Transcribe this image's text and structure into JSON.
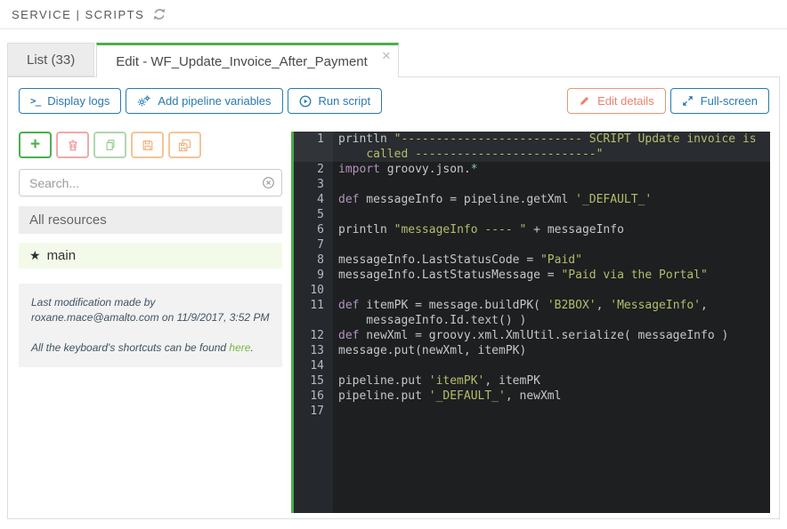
{
  "breadcrumb": {
    "text": "SERVICE | SCRIPTS"
  },
  "tabs": {
    "list": {
      "label": "List (33)"
    },
    "edit": {
      "label": "Edit - WF_Update_Invoice_After_Payment",
      "close_label": "×"
    }
  },
  "toolbar": {
    "display_logs": "Display logs",
    "terminal_glyph": ">_",
    "add_pipeline_variables": "Add pipeline variables",
    "run_script": "Run script",
    "edit_details": "Edit details",
    "full_screen": "Full-screen"
  },
  "sidebar": {
    "icon_buttons": [
      "add",
      "delete",
      "duplicate",
      "save",
      "save-all"
    ],
    "search_placeholder": "Search...",
    "all_resources_label": "All resources",
    "main_item_label": "main",
    "star_glyph": "★",
    "plus_glyph": "+",
    "info_line1": "Last modification made by roxane.mace@amalto.com on 11/9/2017, 3:52 PM",
    "shortcuts_prefix": "All the keyboard's shortcuts can be found ",
    "shortcuts_link": "here",
    "shortcuts_suffix": "."
  },
  "colors": {
    "accent_green": "#4cae4c",
    "accent_blue": "#2779af",
    "accent_orange": "#e8836f",
    "editor_bg": "#1d1f21",
    "editor_gutter_bg": "#25282c",
    "code_string": "#b5bd68",
    "code_keyword": "#b294bb",
    "code_plain": "#c5c8c6",
    "info_link_green": "#7ab648"
  },
  "editor": {
    "lines": [
      {
        "n": 1,
        "active": true,
        "rows": [
          [
            [
              "println ",
              "p"
            ],
            [
              "\"-------------------------- SCRIPT Update invoice is",
              "s"
            ]
          ],
          [
            [
              "    ",
              "p"
            ],
            [
              "called --------------------------\"",
              "s"
            ]
          ]
        ]
      },
      {
        "n": 2,
        "rows": [
          [
            [
              "import",
              "k"
            ],
            [
              " groovy.json.",
              "p"
            ],
            [
              "*",
              "c"
            ]
          ]
        ]
      },
      {
        "n": 3,
        "rows": [
          []
        ]
      },
      {
        "n": 4,
        "rows": [
          [
            [
              "def",
              "k"
            ],
            [
              " messageInfo = pipeline.getXml ",
              "p"
            ],
            [
              "'_DEFAULT_'",
              "s"
            ]
          ]
        ]
      },
      {
        "n": 5,
        "rows": [
          []
        ]
      },
      {
        "n": 6,
        "rows": [
          [
            [
              "println ",
              "p"
            ],
            [
              "\"messageInfo ---- \"",
              "s"
            ],
            [
              " + messageInfo",
              "p"
            ]
          ]
        ]
      },
      {
        "n": 7,
        "rows": [
          []
        ]
      },
      {
        "n": 8,
        "rows": [
          [
            [
              "messageInfo.LastStatusCode = ",
              "p"
            ],
            [
              "\"Paid\"",
              "s"
            ]
          ]
        ]
      },
      {
        "n": 9,
        "rows": [
          [
            [
              "messageInfo.LastStatusMessage = ",
              "p"
            ],
            [
              "\"Paid via the Portal\"",
              "s"
            ]
          ]
        ]
      },
      {
        "n": 10,
        "rows": [
          []
        ]
      },
      {
        "n": 11,
        "rows": [
          [
            [
              "def",
              "k"
            ],
            [
              " itemPK = message.buildPK( ",
              "p"
            ],
            [
              "'B2BOX'",
              "s"
            ],
            [
              ", ",
              "p"
            ],
            [
              "'MessageInfo'",
              "s"
            ],
            [
              ",",
              "p"
            ]
          ],
          [
            [
              "    messageInfo.Id.text() )",
              "p"
            ]
          ]
        ]
      },
      {
        "n": 12,
        "rows": [
          [
            [
              "def",
              "k"
            ],
            [
              " newXml = groovy.xml.XmlUtil.serialize( messageInfo )",
              "p"
            ]
          ]
        ]
      },
      {
        "n": 13,
        "rows": [
          [
            [
              "message.put(newXml, itemPK)",
              "p"
            ]
          ]
        ]
      },
      {
        "n": 14,
        "rows": [
          []
        ]
      },
      {
        "n": 15,
        "rows": [
          [
            [
              "pipeline.put ",
              "p"
            ],
            [
              "'itemPK'",
              "s"
            ],
            [
              ", itemPK",
              "p"
            ]
          ]
        ]
      },
      {
        "n": 16,
        "rows": [
          [
            [
              "pipeline.put ",
              "p"
            ],
            [
              "'_DEFAULT_'",
              "s"
            ],
            [
              ", newXml",
              "p"
            ]
          ]
        ]
      },
      {
        "n": 17,
        "rows": [
          []
        ]
      }
    ]
  }
}
